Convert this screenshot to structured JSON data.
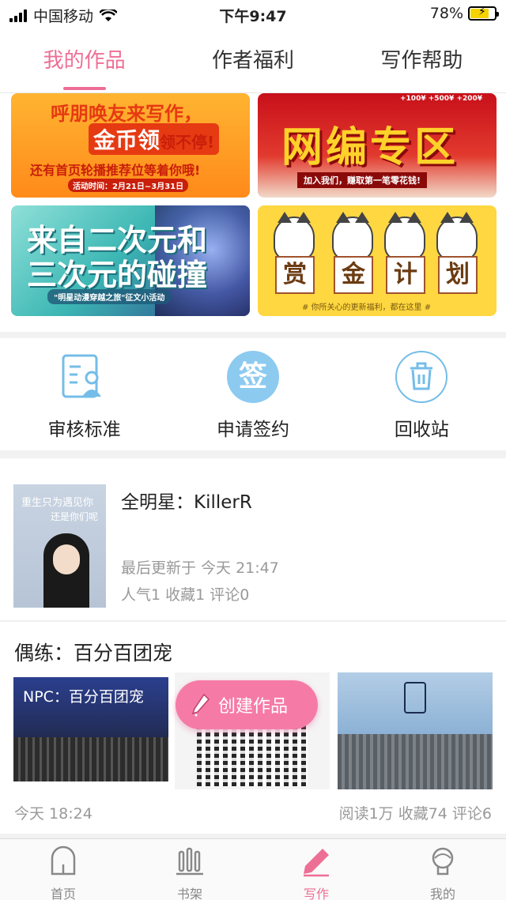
{
  "status_bar": {
    "carrier": "中国移动",
    "time": "下午9:47",
    "battery": "78%",
    "battery_level": 0.78
  },
  "top_tabs": [
    {
      "label": "我的作品",
      "active": true
    },
    {
      "label": "作者福利",
      "active": false
    },
    {
      "label": "写作帮助",
      "active": false
    }
  ],
  "banners": {
    "b1": {
      "line1": "呼朋唤友来写作，",
      "line2": "金币领",
      "line2b": "领不停!",
      "line3": "还有首页轮播推荐位等着你哦!",
      "line4": "活动时间：2月21日~3月31日"
    },
    "b2": {
      "title": "网编专区",
      "sub": "加入我们，赚取第一笔零花钱!",
      "coins": "+100¥ +500¥ +200¥"
    },
    "b3": {
      "title_line1": "来自二次元和",
      "title_line2": "三次元的碰撞",
      "sub": "\"明星动漫穿越之旅\"征文小活动"
    },
    "b4": {
      "chars": [
        "赏",
        "金",
        "计",
        "划"
      ],
      "sub": "# 你所关心的更新福利，都在这里 #"
    }
  },
  "actions": [
    {
      "label": "审核标准",
      "icon": "review-standards-icon"
    },
    {
      "label": "申请签约",
      "icon": "sign-contract-icon",
      "icon_text": "签"
    },
    {
      "label": "回收站",
      "icon": "recycle-bin-icon"
    }
  ],
  "work1": {
    "cover_line1": "重生只为遇见你",
    "cover_line2": "还是你们呢",
    "title": "全明星：KillerR",
    "updated": "最后更新于 今天 21:47",
    "stats": "人气1 收藏1 评论0"
  },
  "work2": {
    "title": "偶练：百分百团宠",
    "thumb1_text": "NPC：百分百团宠",
    "date": "今天 18:24",
    "stats": "阅读1万 收藏74 评论6"
  },
  "create_button": {
    "label": "创建作品"
  },
  "bottom_nav": [
    {
      "label": "首页",
      "icon": "home-icon",
      "active": false
    },
    {
      "label": "书架",
      "icon": "bookshelf-icon",
      "active": false
    },
    {
      "label": "写作",
      "icon": "pen-icon",
      "active": true
    },
    {
      "label": "我的",
      "icon": "profile-icon",
      "active": false
    }
  ],
  "colors": {
    "accent": "#ee6f96",
    "create_button": "#f57ba6",
    "icon_blue": "#74bde8"
  }
}
